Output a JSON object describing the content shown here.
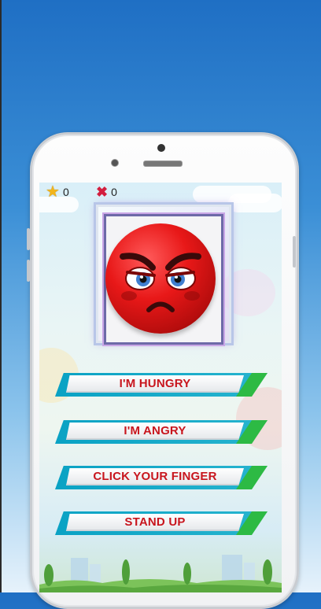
{
  "hud": {
    "stars_count": "0",
    "misses_count": "0",
    "star_icon": "star-icon",
    "miss_icon": "close-icon"
  },
  "emoji": {
    "icon": "angry-face-icon"
  },
  "menu": {
    "buttons": [
      {
        "label": "I'M HUNGRY"
      },
      {
        "label": "I'M ANGRY"
      },
      {
        "label": "CLICK YOUR FINGER"
      },
      {
        "label": "STAND UP"
      }
    ]
  },
  "colors": {
    "button_text": "#c8151d",
    "button_back": "#0aa2c4",
    "button_accent": "#2dba44",
    "star": "#f2b51b",
    "miss": "#d31f3f"
  }
}
